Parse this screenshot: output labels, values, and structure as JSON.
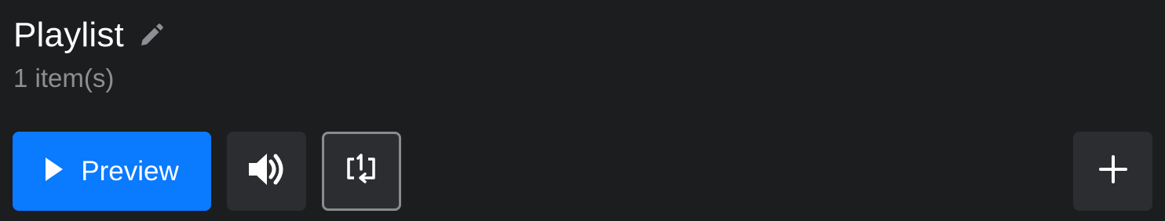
{
  "playlist": {
    "title": "Playlist",
    "item_count": "1 item(s)",
    "edit_icon": "pencil-icon"
  },
  "toolbar": {
    "preview_label": "Preview",
    "preview_icon": "play-icon",
    "sound_icon": "speaker-icon",
    "repeat_icon": "repeat-one-icon",
    "add_icon": "plus-icon"
  },
  "colors": {
    "background": "#1c1d1f",
    "accent": "#0a7aff",
    "button_bg": "#2c2d30",
    "muted_text": "#8e8f92"
  }
}
